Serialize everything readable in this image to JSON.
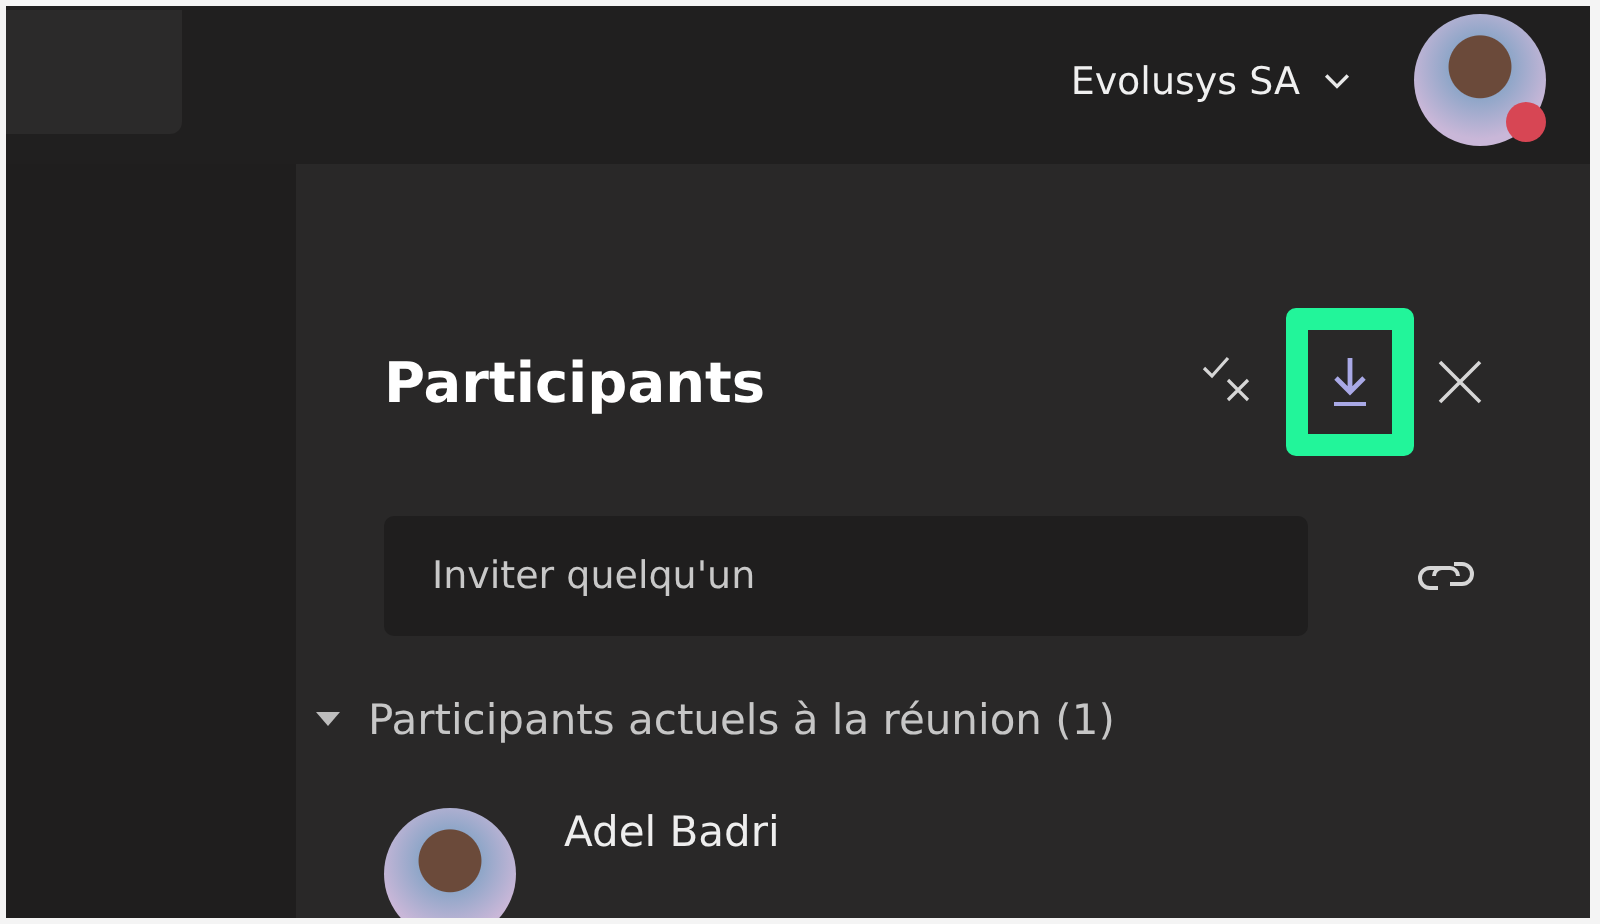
{
  "top_bar": {
    "org_label": "Evolusys SA"
  },
  "panel": {
    "title": "Participants",
    "invite_field": {
      "placeholder": "Inviter quelqu'un"
    }
  },
  "section": {
    "label": "Participants actuels à la réunion (1)",
    "expanded": true,
    "participants": [
      {
        "name": "Adel Badri"
      }
    ]
  }
}
